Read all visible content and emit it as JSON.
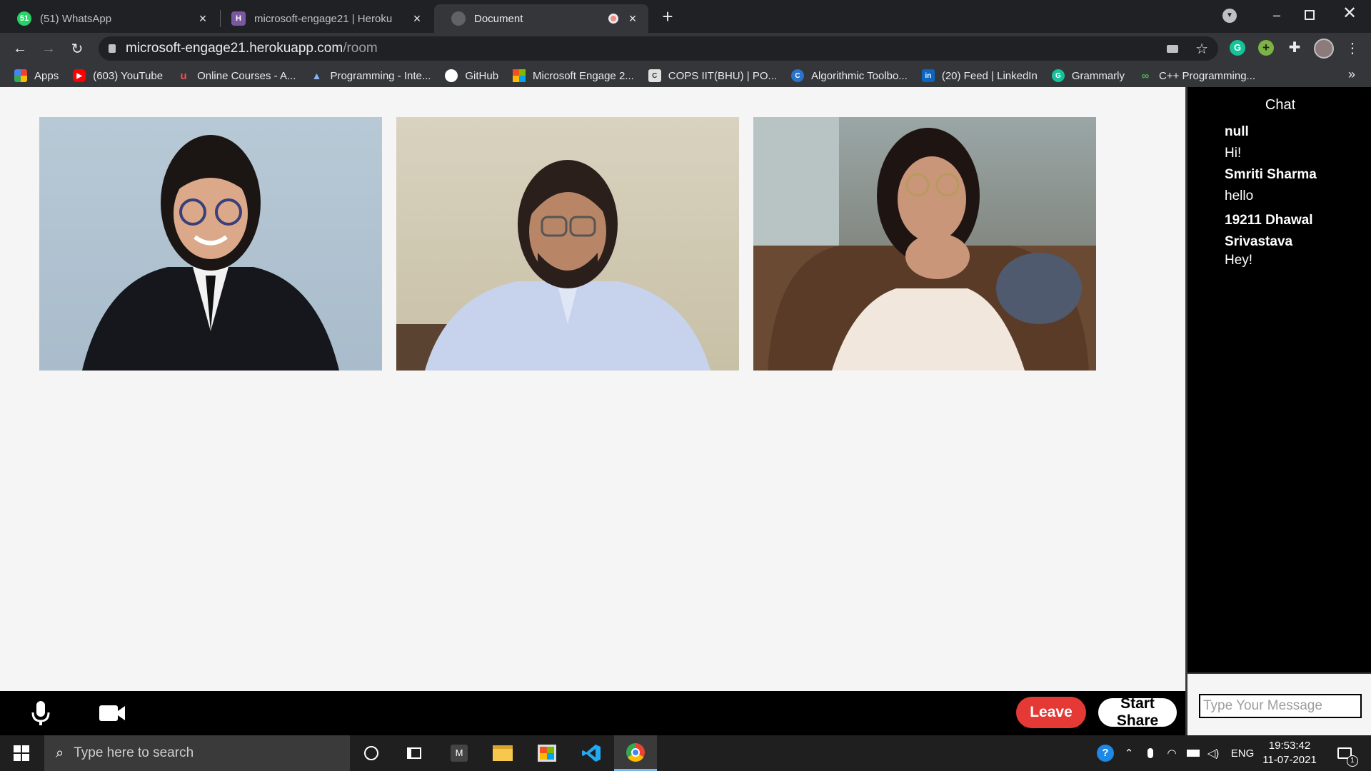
{
  "browser": {
    "tabs": [
      {
        "title": "(51) WhatsApp",
        "icon": "whatsapp-icon",
        "badge": "51",
        "active": false
      },
      {
        "title": "microsoft-engage21 | Heroku",
        "icon": "heroku-icon",
        "badge": "H",
        "active": false
      },
      {
        "title": "Document",
        "icon": "globe-icon",
        "badge": "",
        "active": true
      }
    ],
    "new_tab": "+",
    "close_glyph": "×",
    "url_host": "microsoft-engage21.herokuapp.com",
    "url_path": "/room",
    "bookmarks": [
      {
        "label": "Apps",
        "icon": "apps-grid-icon",
        "color": "#4285f4",
        "glyph": ""
      },
      {
        "label": "(603) YouTube",
        "icon": "youtube-icon",
        "color": "#ff0000",
        "glyph": "▶"
      },
      {
        "label": "Online Courses - A...",
        "icon": "udemy-icon",
        "color": "#ec5252",
        "glyph": "u"
      },
      {
        "label": "Programming - Inte...",
        "icon": "mountain-icon",
        "color": "#5f8fbf",
        "glyph": "▲"
      },
      {
        "label": "GitHub",
        "icon": "github-icon",
        "color": "#ffffff",
        "glyph": ""
      },
      {
        "label": "Microsoft Engage 2...",
        "icon": "microsoft-icon",
        "color": "#f25022",
        "glyph": ""
      },
      {
        "label": "COPS IIT(BHU) | PO...",
        "icon": "cops-icon",
        "color": "#777777",
        "glyph": "C"
      },
      {
        "label": "Algorithmic Toolbo...",
        "icon": "coursera-icon",
        "color": "#2a73cc",
        "glyph": "C"
      },
      {
        "label": "(20) Feed | LinkedIn",
        "icon": "linkedin-icon",
        "color": "#0a66c2",
        "glyph": "in"
      },
      {
        "label": "Grammarly",
        "icon": "grammarly-icon",
        "color": "#15c39a",
        "glyph": "G"
      },
      {
        "label": "C++ Programming...",
        "icon": "link-icon",
        "color": "#4caf50",
        "glyph": "∞"
      }
    ],
    "more_bookmarks": "»"
  },
  "room": {
    "participants": [
      "participant-1",
      "participant-2",
      "participant-3"
    ],
    "chat": {
      "title": "Chat",
      "messages": [
        {
          "name": "null",
          "text": "Hi!"
        },
        {
          "name": "Smriti Sharma",
          "text": "hello"
        },
        {
          "name": "19211 Dhawal Srivastava",
          "text": "Hey!"
        }
      ],
      "placeholder": "Type Your Message"
    },
    "controls": {
      "leave": "Leave",
      "share": "Start Share",
      "leave_color": "#e53935"
    }
  },
  "taskbar": {
    "search_placeholder": "Type here to search",
    "language": "ENG",
    "time": "19:53:42",
    "date": "11-07-2021",
    "notification_count": "1"
  }
}
